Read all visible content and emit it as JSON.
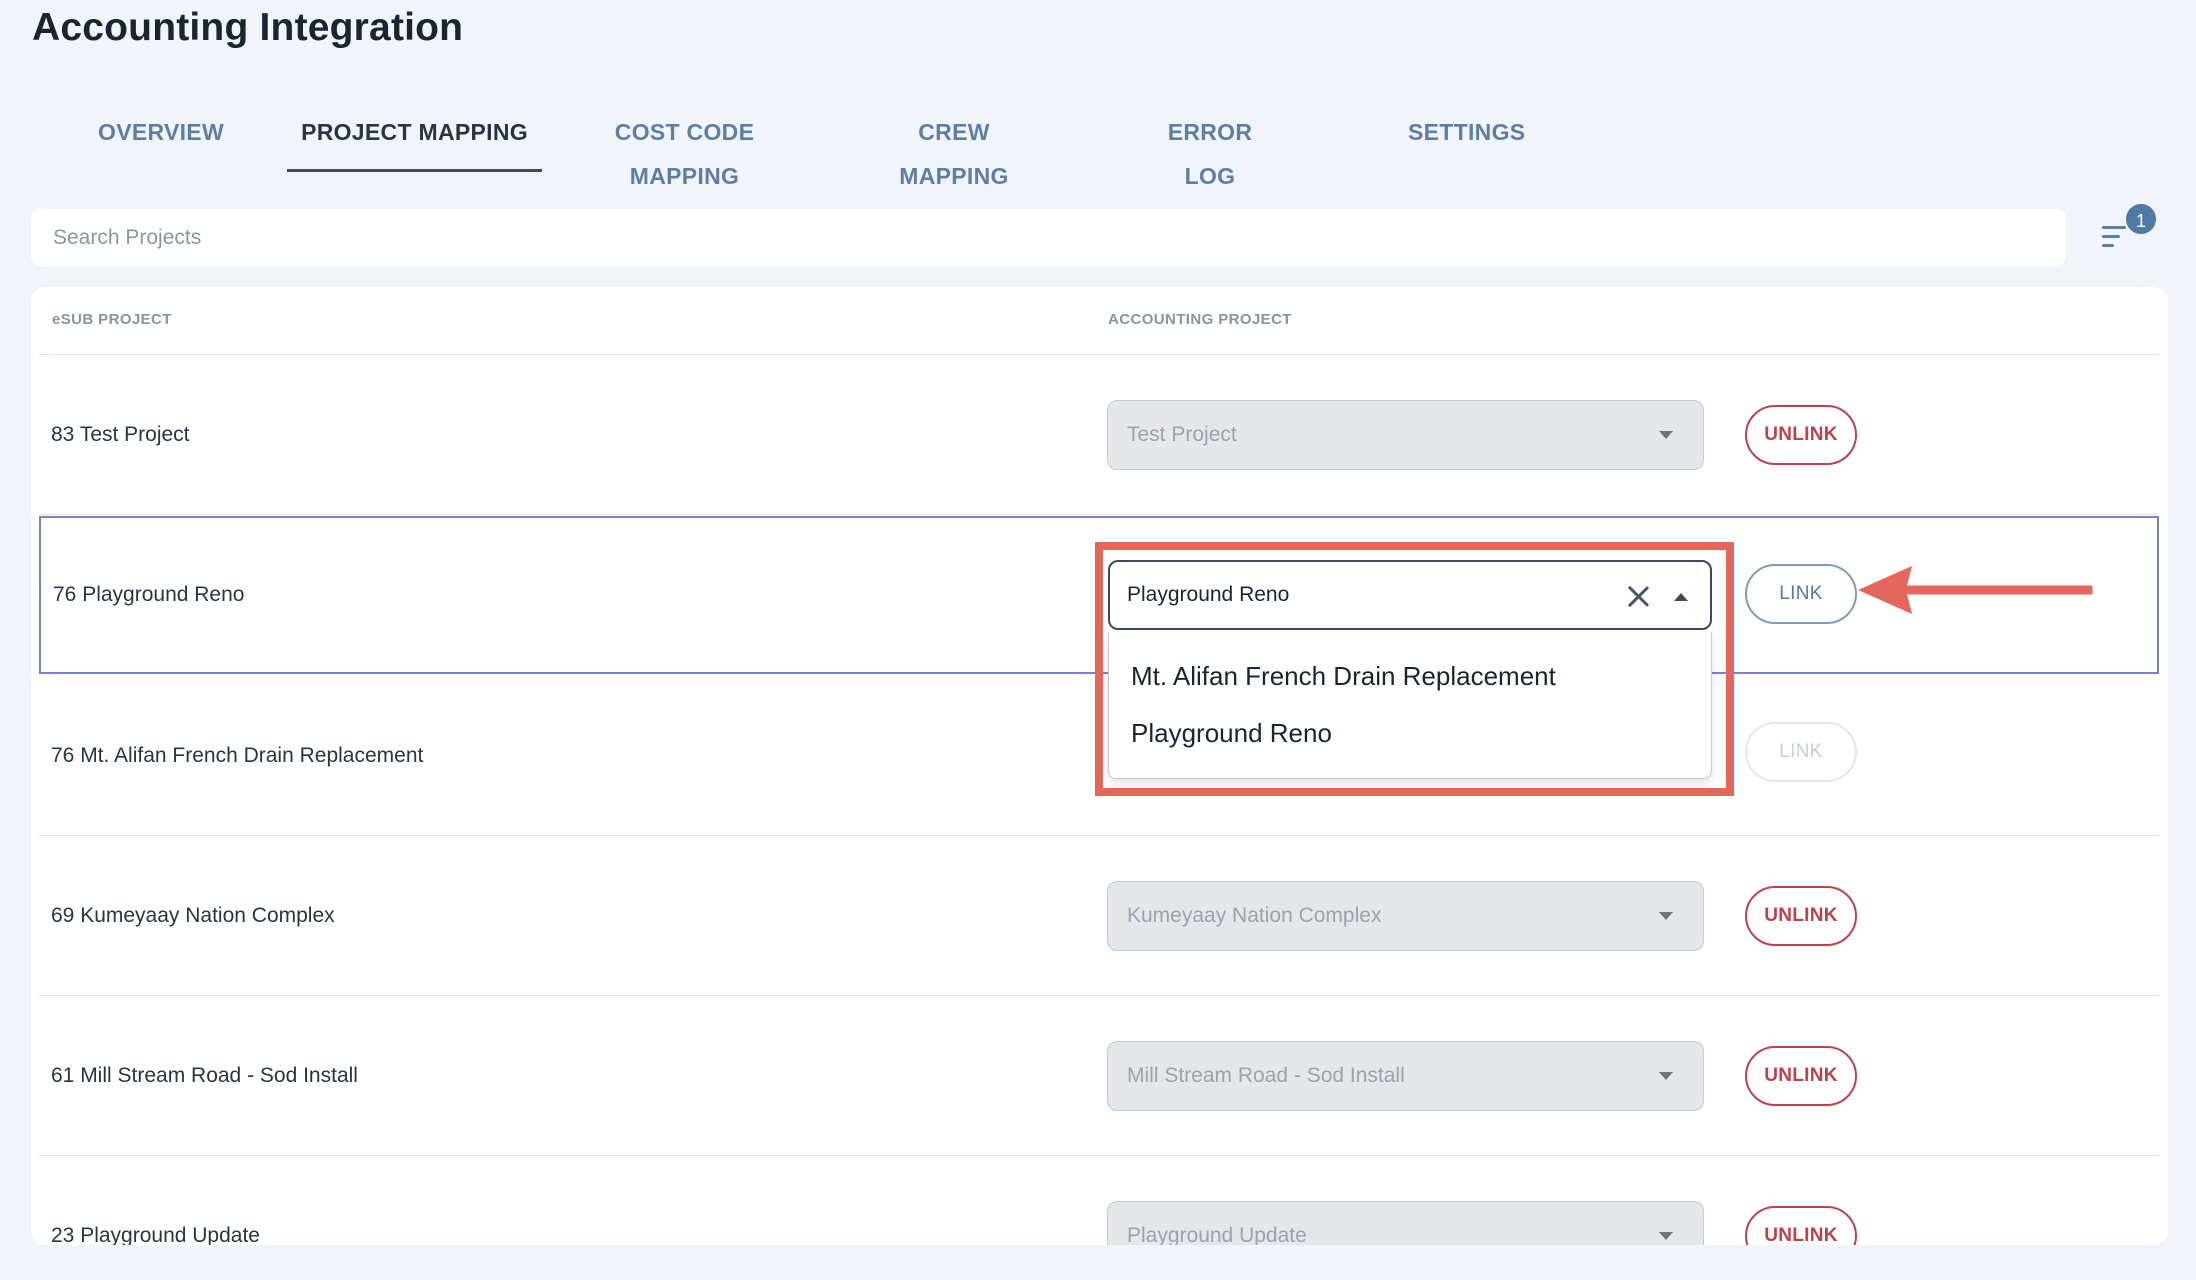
{
  "header": {
    "title": "Accounting Integration"
  },
  "tabs": [
    {
      "label": "OVERVIEW",
      "active": false
    },
    {
      "label": "PROJECT MAPPING",
      "active": true
    },
    {
      "label": "COST CODE MAPPING",
      "active": false
    },
    {
      "label": "CREW MAPPING",
      "active": false
    },
    {
      "label": "ERROR LOG",
      "active": false
    },
    {
      "label": "SETTINGS",
      "active": false
    }
  ],
  "search": {
    "placeholder": "Search Projects",
    "value": ""
  },
  "filter": {
    "icon": "filter-lines-icon",
    "badge_count": "1"
  },
  "table": {
    "columns": {
      "esub": "eSUB PROJECT",
      "accounting": "ACCOUNTING PROJECT"
    },
    "rows": [
      {
        "esub_project": "83 Test Project",
        "accounting_project": "Test Project",
        "action": "UNLINK"
      },
      {
        "esub_project": "76 Playground Reno",
        "accounting_project": "Playground Reno",
        "action": "LINK",
        "selected": true
      },
      {
        "esub_project": "76 Mt. Alifan French Drain Replacement",
        "accounting_project": "",
        "action": "LINK",
        "disabled": true
      },
      {
        "esub_project": "69 Kumeyaay Nation Complex",
        "accounting_project": "Kumeyaay Nation Complex",
        "action": "UNLINK"
      },
      {
        "esub_project": "61 Mill Stream Road - Sod Install",
        "accounting_project": "Mill Stream Road - Sod Install",
        "action": "UNLINK"
      },
      {
        "esub_project": "23 Playground Update",
        "accounting_project": "Playground Update",
        "action": "UNLINK"
      }
    ]
  },
  "dropdown": {
    "options": [
      "Mt. Alifan French Drain Replacement",
      "Playground Reno"
    ]
  },
  "annotation": {
    "highlight_color": "#e5675c",
    "arrow_color": "#e5675c"
  }
}
